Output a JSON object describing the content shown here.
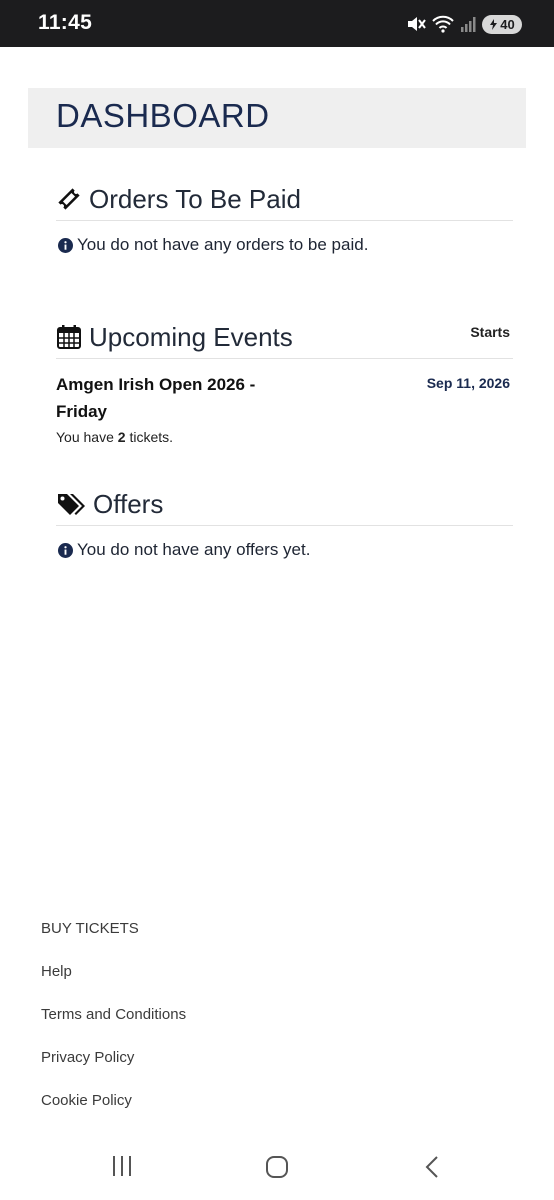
{
  "status_bar": {
    "time": "11:45",
    "battery_level": "40",
    "icons": [
      "mute-icon",
      "wifi-icon",
      "signal-icon",
      "battery-icon"
    ]
  },
  "dashboard": {
    "title": "DASHBOARD"
  },
  "orders": {
    "title": "Orders To Be Paid",
    "icon": "ticket-icon",
    "empty_message": "You do not have any orders to be paid."
  },
  "events": {
    "title": "Upcoming Events",
    "icon": "calendar-icon",
    "starts_label": "Starts",
    "items": [
      {
        "name": "Amgen Irish Open 2026 - Friday",
        "date": "Sep 11, 2026",
        "tickets_prefix": "You have ",
        "tickets_count": "2",
        "tickets_suffix": " tickets."
      }
    ]
  },
  "offers": {
    "title": "Offers",
    "icon": "tags-icon",
    "empty_message": "You do not have any offers yet."
  },
  "footer": {
    "links": [
      "BUY TICKETS",
      "Help",
      "Terms and Conditions",
      "Privacy Policy",
      "Cookie Policy"
    ]
  },
  "nav_bar": {
    "buttons": [
      "recent-apps-icon",
      "home-icon",
      "back-icon"
    ]
  },
  "colors": {
    "title": "#1a2a4f",
    "header_band": "#efefef",
    "status_bar": "#1c1c1e"
  }
}
